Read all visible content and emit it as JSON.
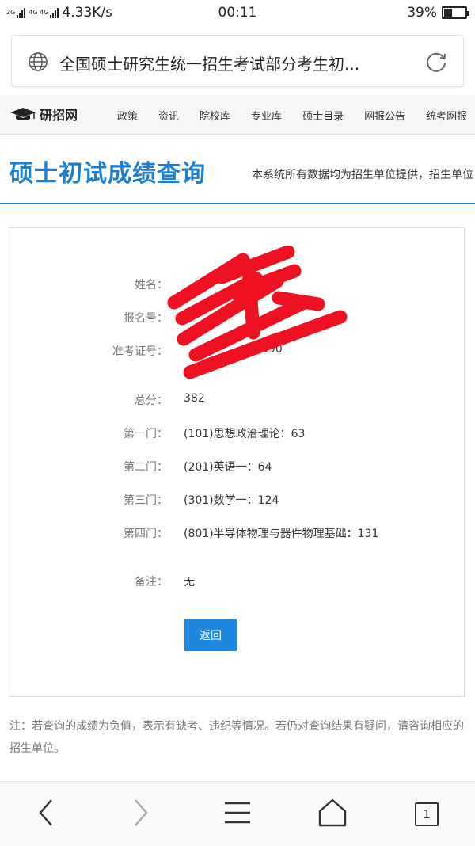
{
  "status_bar": {
    "net1": "2G",
    "net2": "4G 4G",
    "speed": "4.33K/s",
    "time": "00:11",
    "battery": "39%",
    "battery_level": 0.39
  },
  "url_bar": {
    "title": "全国硕士研究生统一招生考试部分考生初..."
  },
  "site_nav": {
    "logo": "研招网",
    "items": [
      "政策",
      "资讯",
      "院校库",
      "专业库",
      "硕士目录",
      "网报公告",
      "统考网报"
    ]
  },
  "page": {
    "title": "硕士初试成绩查询",
    "subtitle": "本系统所有数据均为招生单位提供，招生单位"
  },
  "result": {
    "identity": [
      {
        "label": "姓名：",
        "value": ""
      },
      {
        "label": "报名号：",
        "value": ""
      },
      {
        "label": "准考证号：",
        "value": "090"
      }
    ],
    "scores": [
      {
        "label": "总分：",
        "value": "382"
      },
      {
        "label": "第一门：",
        "value": "(101)思想政治理论：63"
      },
      {
        "label": "第二门：",
        "value": "(201)英语一：64"
      },
      {
        "label": "第三门：",
        "value": "(301)数学一：124"
      },
      {
        "label": "第四门：",
        "value": "(801)半导体物理与器件物理基础：131"
      }
    ],
    "remark": {
      "label": "备注：",
      "value": "无"
    },
    "back_label": "返回"
  },
  "note": "注：若查询的成绩为负值，表示有缺考、违纪等情况。若仍对查询结果有疑问，请咨询相应的招生单位。",
  "bottom_nav": {
    "tab_count": "1"
  },
  "colors": {
    "accent": "#1e7fd0",
    "button": "#1e88e0",
    "redaction": "#ee1122"
  }
}
